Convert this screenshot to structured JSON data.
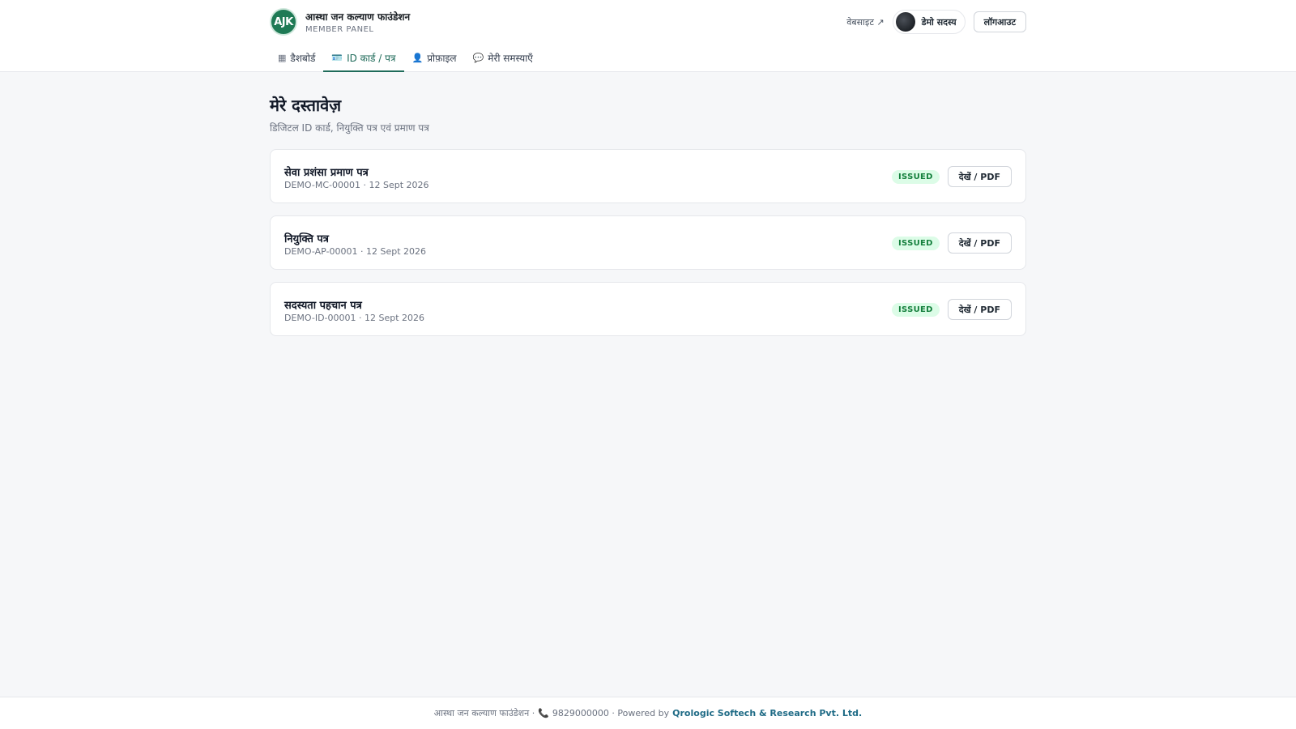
{
  "header": {
    "logo_text": "AJK",
    "org_name": "आस्था जन कल्याण फाउंडेशन",
    "panel_label": "MEMBER PANEL",
    "website_label": "वेबसाइट ↗",
    "user_name": "डेमो सदस्य",
    "logout_label": "लॉगआउट"
  },
  "tabs": [
    {
      "icon": "▦",
      "icon_name": "dashboard-icon",
      "label": "डैशबोर्ड",
      "active": false
    },
    {
      "icon": "🪪",
      "icon_name": "id-card-icon",
      "label": "ID कार्ड / पत्र",
      "active": true
    },
    {
      "icon": "👤",
      "icon_name": "user-icon",
      "label": "प्रोफ़ाइल",
      "active": false
    },
    {
      "icon": "💬",
      "icon_name": "chat-icon",
      "label": "मेरी समस्याएँ",
      "active": false
    }
  ],
  "main": {
    "title": "मेरे दस्तावेज़",
    "subtitle": "डिजिटल ID कार्ड, नियुक्ति पत्र एवं प्रमाण पत्र",
    "documents": [
      {
        "title": "सेवा प्रशंसा प्रमाण पत्र",
        "meta": "DEMO-MC-00001 · 12 Sept 2026",
        "status": "ISSUED",
        "action_label": "देखें / PDF"
      },
      {
        "title": "नियुक्ति पत्र",
        "meta": "DEMO-AP-00001 · 12 Sept 2026",
        "status": "ISSUED",
        "action_label": "देखें / PDF"
      },
      {
        "title": "सदस्यता पहचान पत्र",
        "meta": "DEMO-ID-00001 · 12 Sept 2026",
        "status": "ISSUED",
        "action_label": "देखें / PDF"
      }
    ]
  },
  "footer": {
    "org_name": "आस्था जन कल्याण फाउंडेशन ·",
    "phone_icon": "📞",
    "phone": "9829000000 · Powered by",
    "credit": "Qrologic Softech & Research Pvt. Ltd."
  },
  "colors": {
    "accent": "#1f6b5a",
    "logo_bg": "#1f7a55",
    "status_green": "#15803d",
    "status_bg": "#dcfce7",
    "link": "#1f6b86"
  }
}
